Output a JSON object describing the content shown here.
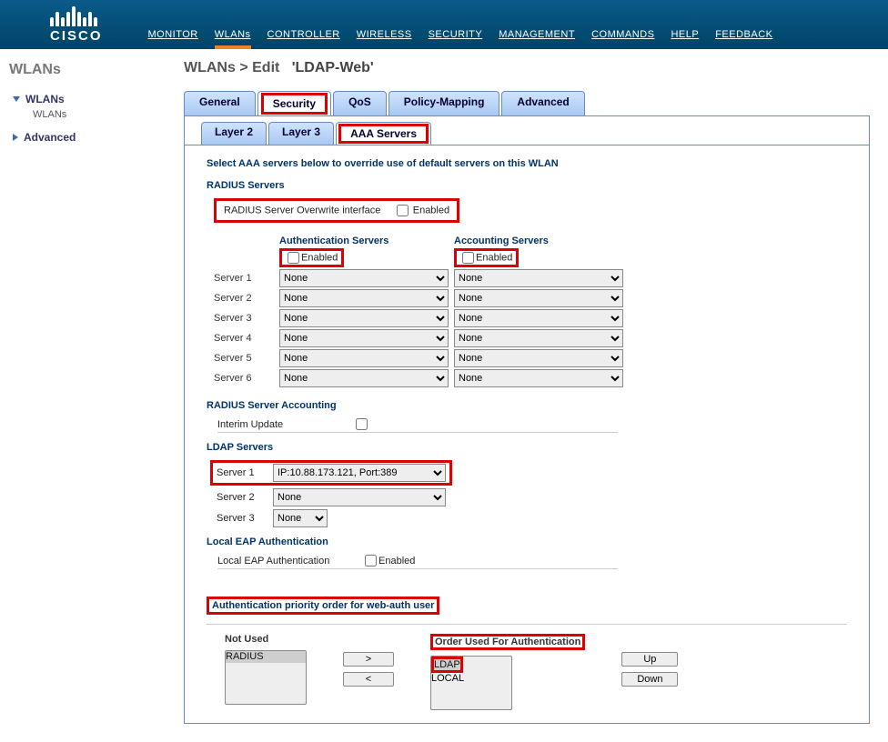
{
  "brand": "CISCO",
  "topnav": {
    "monitor": "MONITOR",
    "wlan": "WLANs",
    "controller": "CONTROLLER",
    "wireless": "WIRELESS",
    "security": "SECURITY",
    "management": "MANAGEMENT",
    "commands": "COMMANDS",
    "help": "HELP",
    "feedback": "FEEDBACK"
  },
  "sidebar": {
    "title": "WLANs",
    "items": [
      {
        "label": "WLANs",
        "expanded": true,
        "children": [
          {
            "label": "WLANs"
          }
        ]
      },
      {
        "label": "Advanced",
        "expanded": false
      }
    ]
  },
  "breadcrumb": {
    "section": "WLANs",
    "action": "Edit",
    "name": "'LDAP-Web'"
  },
  "tabs": {
    "general": "General",
    "security": "Security",
    "qos": "QoS",
    "policy": "Policy-Mapping",
    "advanced": "Advanced"
  },
  "subtabs": {
    "l2": "Layer 2",
    "l3": "Layer 3",
    "aaa": "AAA Servers"
  },
  "aaa": {
    "instruction": "Select AAA servers below to override use of default servers on this WLAN",
    "radius_header": "RADIUS Servers",
    "overwrite_label": "RADIUS Server Overwrite interface",
    "enabled_label": "Enabled",
    "auth_servers_header": "Authentication Servers",
    "acct_servers_header": "Accounting Servers",
    "server_labels": [
      "Server 1",
      "Server 2",
      "Server 3",
      "Server 4",
      "Server 5",
      "Server 6"
    ],
    "none_option": "None",
    "radius_acct_header": "RADIUS Server Accounting",
    "interim_update": "Interim Update",
    "ldap_header": "LDAP Servers",
    "ldap_servers": [
      {
        "label": "Server 1",
        "value": "IP:10.88.173.121, Port:389"
      },
      {
        "label": "Server 2",
        "value": "None"
      },
      {
        "label": "Server 3",
        "value": "None"
      }
    ],
    "local_eap_header": "Local EAP Authentication",
    "local_eap_label": "Local EAP Authentication",
    "auth_priority_header": "Authentication priority order for web-auth user",
    "not_used": "Not Used",
    "order_used": "Order Used For Authentication",
    "not_used_items": [
      "RADIUS"
    ],
    "order_items": [
      "LDAP",
      "LOCAL"
    ],
    "btn_right": ">",
    "btn_left": "<",
    "btn_up": "Up",
    "btn_down": "Down"
  }
}
